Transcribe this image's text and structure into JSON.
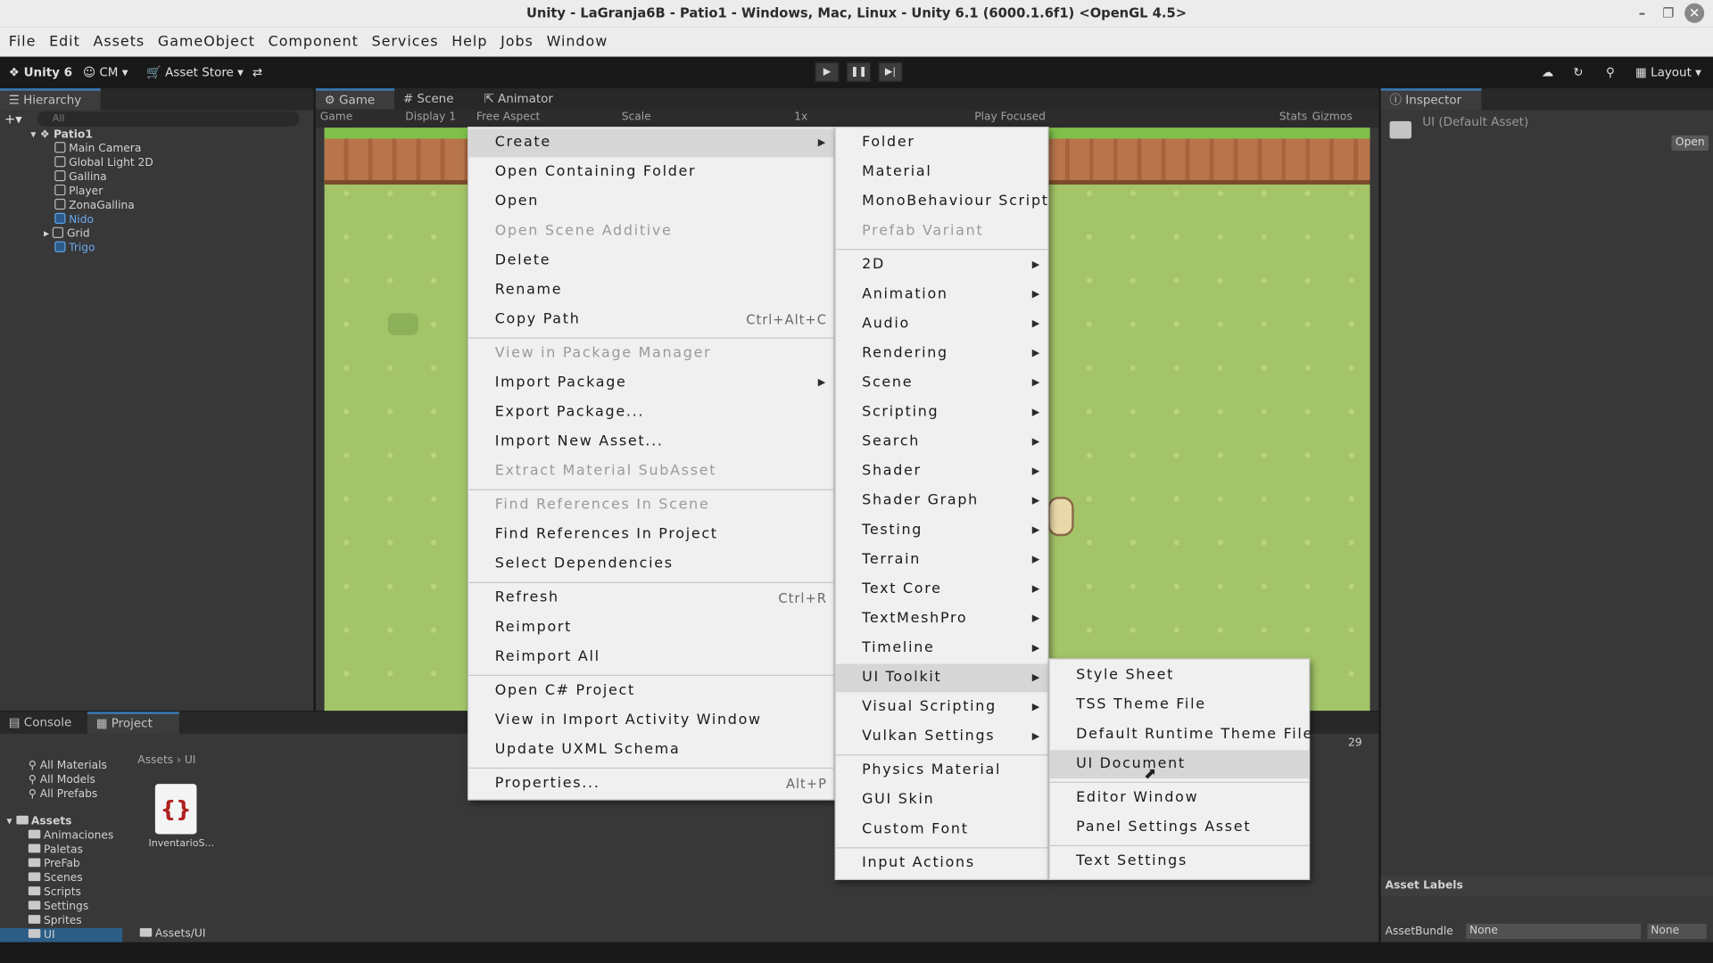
{
  "window": {
    "title": "Unity - LaGranja6B - Patio1 - Windows, Mac, Linux - Unity 6.1 (6000.1.6f1) <OpenGL 4.5>"
  },
  "menubar": [
    "File",
    "Edit",
    "Assets",
    "GameObject",
    "Component",
    "Services",
    "Help",
    "Jobs",
    "Window"
  ],
  "toolbar": {
    "unity": "Unity 6",
    "account": "CM",
    "asset_store": "Asset Store",
    "layout": "Layout"
  },
  "hierarchy": {
    "tab": "Hierarchy",
    "search_placeholder": "All",
    "scene": "Patio1",
    "items": [
      "Main Camera",
      "Global Light 2D",
      "Gallina",
      "Player",
      "ZonaGallina",
      "Nido",
      "Grid",
      "Trigo"
    ]
  },
  "game": {
    "tabs": [
      "Game",
      "Scene",
      "Animator"
    ],
    "mode": "Game",
    "display": "Display 1",
    "aspect": "Free Aspect",
    "scale_label": "Scale",
    "scale_value": "1x",
    "play_focused": "Play Focused",
    "stats": "Stats",
    "gizmos": "Gizmos"
  },
  "inspector": {
    "tab": "Inspector",
    "asset": "UI (Default Asset)",
    "open": "Open",
    "labels": "Asset Labels",
    "bundle_label": "AssetBundle",
    "bundle_value": "None",
    "variant_value": "None"
  },
  "bottom": {
    "tabs": [
      "Console",
      "Project"
    ],
    "favorites": [
      "All Materials",
      "All Models",
      "All Prefabs"
    ],
    "assets_root": "Assets",
    "folders": [
      "Animaciones",
      "Paletas",
      "PreFab",
      "Scenes",
      "Scripts",
      "Settings",
      "Sprites",
      "UI"
    ],
    "breadcrumb": [
      "Assets",
      "UI"
    ],
    "file": "InventarioS...",
    "path": "Assets/UI",
    "count": "29"
  },
  "context_menu": {
    "items": [
      {
        "label": "Create",
        "state": "hl",
        "arrow": true
      },
      {
        "label": "Open Containing Folder"
      },
      {
        "label": "Open"
      },
      {
        "label": "Open Scene Additive",
        "state": "dis"
      },
      {
        "label": "Delete"
      },
      {
        "label": "Rename"
      },
      {
        "label": "Copy Path",
        "shortcut": "Ctrl+Alt+C"
      },
      {
        "label": "View in Package Manager",
        "state": "dis"
      },
      {
        "label": "Import Package",
        "arrow": true
      },
      {
        "label": "Export Package..."
      },
      {
        "label": "Import New Asset..."
      },
      {
        "label": "Extract Material SubAsset",
        "state": "dis"
      },
      {
        "label": "Find References In Scene",
        "state": "dis"
      },
      {
        "label": "Find References In Project"
      },
      {
        "label": "Select Dependencies"
      },
      {
        "label": "Refresh",
        "shortcut": "Ctrl+R"
      },
      {
        "label": "Reimport"
      },
      {
        "label": "Reimport All"
      },
      {
        "label": "Open C# Project"
      },
      {
        "label": "View in Import Activity Window"
      },
      {
        "label": "Update UXML Schema"
      },
      {
        "label": "Properties...",
        "shortcut": "Alt+P"
      }
    ]
  },
  "create_menu": {
    "items": [
      {
        "label": "Folder"
      },
      {
        "label": "Material"
      },
      {
        "label": "MonoBehaviour Script"
      },
      {
        "label": "Prefab Variant",
        "state": "dis"
      },
      {
        "label": "2D",
        "arrow": true
      },
      {
        "label": "Animation",
        "arrow": true
      },
      {
        "label": "Audio",
        "arrow": true
      },
      {
        "label": "Rendering",
        "arrow": true
      },
      {
        "label": "Scene",
        "arrow": true
      },
      {
        "label": "Scripting",
        "arrow": true
      },
      {
        "label": "Search",
        "arrow": true
      },
      {
        "label": "Shader",
        "arrow": true
      },
      {
        "label": "Shader Graph",
        "arrow": true
      },
      {
        "label": "Testing",
        "arrow": true
      },
      {
        "label": "Terrain",
        "arrow": true
      },
      {
        "label": "Text Core",
        "arrow": true
      },
      {
        "label": "TextMeshPro",
        "arrow": true
      },
      {
        "label": "Timeline",
        "arrow": true
      },
      {
        "label": "UI Toolkit",
        "arrow": true,
        "state": "hl"
      },
      {
        "label": "Visual Scripting",
        "arrow": true
      },
      {
        "label": "Vulkan Settings",
        "arrow": true
      },
      {
        "label": "Physics Material"
      },
      {
        "label": "GUI Skin"
      },
      {
        "label": "Custom Font"
      },
      {
        "label": "Input Actions"
      }
    ]
  },
  "uitoolkit_menu": {
    "items": [
      {
        "label": "Style Sheet"
      },
      {
        "label": "TSS Theme File"
      },
      {
        "label": "Default Runtime Theme File"
      },
      {
        "label": "UI Document",
        "state": "hl"
      },
      {
        "label": "Editor Window"
      },
      {
        "label": "Panel Settings Asset"
      },
      {
        "label": "Text Settings"
      }
    ]
  }
}
